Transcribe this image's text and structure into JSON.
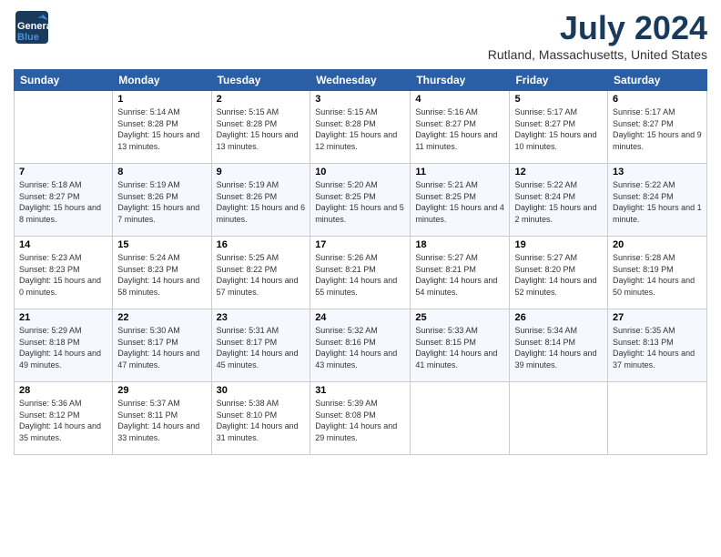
{
  "header": {
    "logo_general": "General",
    "logo_blue": "Blue",
    "month": "July 2024",
    "location": "Rutland, Massachusetts, United States"
  },
  "weekdays": [
    "Sunday",
    "Monday",
    "Tuesday",
    "Wednesday",
    "Thursday",
    "Friday",
    "Saturday"
  ],
  "weeks": [
    [
      {
        "day": "",
        "info": ""
      },
      {
        "day": "1",
        "info": "Sunrise: 5:14 AM\nSunset: 8:28 PM\nDaylight: 15 hours\nand 13 minutes."
      },
      {
        "day": "2",
        "info": "Sunrise: 5:15 AM\nSunset: 8:28 PM\nDaylight: 15 hours\nand 13 minutes."
      },
      {
        "day": "3",
        "info": "Sunrise: 5:15 AM\nSunset: 8:28 PM\nDaylight: 15 hours\nand 12 minutes."
      },
      {
        "day": "4",
        "info": "Sunrise: 5:16 AM\nSunset: 8:27 PM\nDaylight: 15 hours\nand 11 minutes."
      },
      {
        "day": "5",
        "info": "Sunrise: 5:17 AM\nSunset: 8:27 PM\nDaylight: 15 hours\nand 10 minutes."
      },
      {
        "day": "6",
        "info": "Sunrise: 5:17 AM\nSunset: 8:27 PM\nDaylight: 15 hours\nand 9 minutes."
      }
    ],
    [
      {
        "day": "7",
        "info": "Sunrise: 5:18 AM\nSunset: 8:27 PM\nDaylight: 15 hours\nand 8 minutes."
      },
      {
        "day": "8",
        "info": "Sunrise: 5:19 AM\nSunset: 8:26 PM\nDaylight: 15 hours\nand 7 minutes."
      },
      {
        "day": "9",
        "info": "Sunrise: 5:19 AM\nSunset: 8:26 PM\nDaylight: 15 hours\nand 6 minutes."
      },
      {
        "day": "10",
        "info": "Sunrise: 5:20 AM\nSunset: 8:25 PM\nDaylight: 15 hours\nand 5 minutes."
      },
      {
        "day": "11",
        "info": "Sunrise: 5:21 AM\nSunset: 8:25 PM\nDaylight: 15 hours\nand 4 minutes."
      },
      {
        "day": "12",
        "info": "Sunrise: 5:22 AM\nSunset: 8:24 PM\nDaylight: 15 hours\nand 2 minutes."
      },
      {
        "day": "13",
        "info": "Sunrise: 5:22 AM\nSunset: 8:24 PM\nDaylight: 15 hours\nand 1 minute."
      }
    ],
    [
      {
        "day": "14",
        "info": "Sunrise: 5:23 AM\nSunset: 8:23 PM\nDaylight: 15 hours\nand 0 minutes."
      },
      {
        "day": "15",
        "info": "Sunrise: 5:24 AM\nSunset: 8:23 PM\nDaylight: 14 hours\nand 58 minutes."
      },
      {
        "day": "16",
        "info": "Sunrise: 5:25 AM\nSunset: 8:22 PM\nDaylight: 14 hours\nand 57 minutes."
      },
      {
        "day": "17",
        "info": "Sunrise: 5:26 AM\nSunset: 8:21 PM\nDaylight: 14 hours\nand 55 minutes."
      },
      {
        "day": "18",
        "info": "Sunrise: 5:27 AM\nSunset: 8:21 PM\nDaylight: 14 hours\nand 54 minutes."
      },
      {
        "day": "19",
        "info": "Sunrise: 5:27 AM\nSunset: 8:20 PM\nDaylight: 14 hours\nand 52 minutes."
      },
      {
        "day": "20",
        "info": "Sunrise: 5:28 AM\nSunset: 8:19 PM\nDaylight: 14 hours\nand 50 minutes."
      }
    ],
    [
      {
        "day": "21",
        "info": "Sunrise: 5:29 AM\nSunset: 8:18 PM\nDaylight: 14 hours\nand 49 minutes."
      },
      {
        "day": "22",
        "info": "Sunrise: 5:30 AM\nSunset: 8:17 PM\nDaylight: 14 hours\nand 47 minutes."
      },
      {
        "day": "23",
        "info": "Sunrise: 5:31 AM\nSunset: 8:17 PM\nDaylight: 14 hours\nand 45 minutes."
      },
      {
        "day": "24",
        "info": "Sunrise: 5:32 AM\nSunset: 8:16 PM\nDaylight: 14 hours\nand 43 minutes."
      },
      {
        "day": "25",
        "info": "Sunrise: 5:33 AM\nSunset: 8:15 PM\nDaylight: 14 hours\nand 41 minutes."
      },
      {
        "day": "26",
        "info": "Sunrise: 5:34 AM\nSunset: 8:14 PM\nDaylight: 14 hours\nand 39 minutes."
      },
      {
        "day": "27",
        "info": "Sunrise: 5:35 AM\nSunset: 8:13 PM\nDaylight: 14 hours\nand 37 minutes."
      }
    ],
    [
      {
        "day": "28",
        "info": "Sunrise: 5:36 AM\nSunset: 8:12 PM\nDaylight: 14 hours\nand 35 minutes."
      },
      {
        "day": "29",
        "info": "Sunrise: 5:37 AM\nSunset: 8:11 PM\nDaylight: 14 hours\nand 33 minutes."
      },
      {
        "day": "30",
        "info": "Sunrise: 5:38 AM\nSunset: 8:10 PM\nDaylight: 14 hours\nand 31 minutes."
      },
      {
        "day": "31",
        "info": "Sunrise: 5:39 AM\nSunset: 8:08 PM\nDaylight: 14 hours\nand 29 minutes."
      },
      {
        "day": "",
        "info": ""
      },
      {
        "day": "",
        "info": ""
      },
      {
        "day": "",
        "info": ""
      }
    ]
  ]
}
